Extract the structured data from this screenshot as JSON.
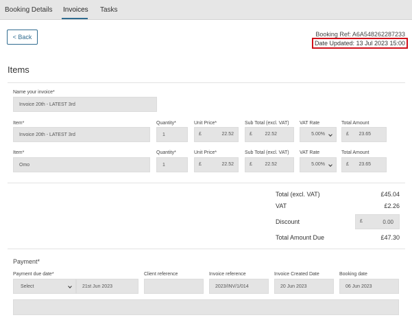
{
  "tabs": [
    {
      "label": "Booking Details"
    },
    {
      "label": "Invoices"
    },
    {
      "label": "Tasks"
    }
  ],
  "back_label": "< Back",
  "booking_ref": "Booking Ref: A6A548262287233",
  "date_updated": "Date Updated: 13 Jul 2023 15:00",
  "items_heading": "Items",
  "invoice_name_label": "Name your invoice*",
  "invoice_name_value": "Invoice 20th - LATEST 3rd",
  "columns": {
    "item": "Item*",
    "quantity": "Quantity*",
    "unit_price": "Unit Price*",
    "sub_total": "Sub Total (excl. VAT)",
    "vat_rate": "VAT Rate",
    "total_amount": "Total Amount"
  },
  "currency": "£",
  "items": [
    {
      "name": "Invoice 20th - LATEST 3rd",
      "quantity": "1",
      "unit_price": "22.52",
      "sub_total": "22.52",
      "vat_rate": "5.00%",
      "total": "23.65"
    },
    {
      "name": "Omo",
      "quantity": "1",
      "unit_price": "22.52",
      "sub_total": "22.52",
      "vat_rate": "5.00%",
      "total": "23.65"
    }
  ],
  "totals": {
    "total_excl_label": "Total (excl. VAT)",
    "total_excl_value": "£45.04",
    "vat_label": "VAT",
    "vat_value": "£2.26",
    "discount_label": "Discount",
    "discount_value": "0.00",
    "amount_due_label": "Total Amount Due",
    "amount_due_value": "£47.30"
  },
  "payment": {
    "heading": "Payment*",
    "due_date_label": "Payment due date*",
    "due_select": "Select",
    "due_date_value": "21st Jun 2023",
    "client_ref_label": "Client reference",
    "client_ref_value": "",
    "invoice_ref_label": "Invoice reference",
    "invoice_ref_value": "2023/INV/1/014",
    "created_label": "Invoice Created Date",
    "created_value": "20 Jun 2023",
    "booking_date_label": "Booking date",
    "booking_date_value": "06 Jun 2023"
  },
  "colors": {
    "accent": "#2f6b8f",
    "highlight": "#d0101a",
    "field": "#e4e4e4"
  }
}
